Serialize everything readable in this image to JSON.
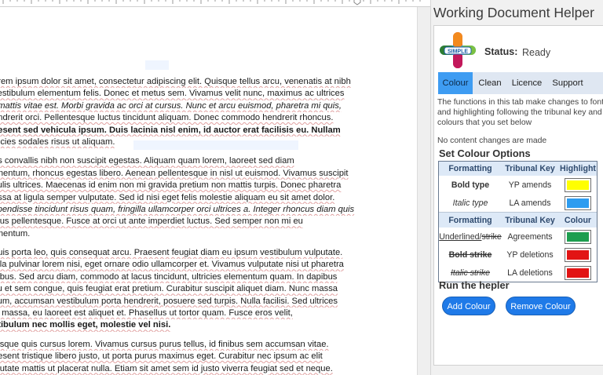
{
  "document": {
    "lines": [
      {
        "text": "orem ipsum dolor sit amet, consectetur adipiscing elit. Quisque tellus arcu, venenatis at nibh",
        "style": "sq"
      },
      {
        "text": " vestibulum elementum felis. Donec et metus sem. Vivamus velit nunc, maximus ac ultrices",
        "style": "sq"
      },
      {
        "text": ", mattis vitae est. Morbi gravida ac orci at cursus. Nunc et arcu euismod, pharetra mi quis,",
        "style": "sq i"
      },
      {
        "text": "endrerit orci. Pellentesque luctus tincidunt aliquam. Donec commodo hendrerit rhoncus.",
        "style": "sq"
      },
      {
        "text": "aesent sed vehicula ipsum. Duis lacinia nisl enim, id auctor erat facilisis eu. Nullam",
        "style": "b sq"
      },
      {
        "text": "tricies sodales risus ut aliquam.",
        "style": "sq"
      },
      {
        "text": "",
        "style": "gap"
      },
      {
        "text": "as  convallis nibh non suscipit egestas. Aliquam quam lorem, laoreet sed diam",
        "style": "sq"
      },
      {
        "text": "rmentum, rhoncus egestas libero. Aenean pellentesque in nisl ut euismod. Vivamus suscipit",
        "style": "sq"
      },
      {
        "text": "culis ultrices. Maecenas id enim non mi gravida pretium non mattis turpis. Donec pharetra",
        "style": "sq"
      },
      {
        "text": "assa at ligula semper vulputate. Sed id nisi eget felis molestie aliquam eu sit amet dolor.",
        "style": "sq"
      },
      {
        "text": "spendisse tincidunt risus quam, fringilla ullamcorper orci ultrices a. Integer rhoncus diam quis",
        "style": "sq i"
      },
      {
        "text": "ibus pellentesque. Fusce at orci ut ante imperdiet luctus. Sed semper non mi eu",
        "style": "sq"
      },
      {
        "text": "rmentum.",
        "style": ""
      },
      {
        "text": "",
        "style": "gap"
      },
      {
        "text": "quis porta leo, quis consequat arcu. Praesent feugiat diam eu ipsum vestibulum vulputate.",
        "style": "sq"
      },
      {
        "text": "ulla pulvinar lorem nisi, eget ornare odio ullamcorper et. Vivamus vulputate nisi ut pharetra",
        "style": "sq"
      },
      {
        "text": "pibus. Sed arcu diam, commodo at lacus tincidunt, ultricies elementum quam. In dapibus",
        "style": "sq"
      },
      {
        "text": "cu et sem congue, quis feugiat erat pretium. Curabitur suscipit aliquet diam. Nunc massa",
        "style": "sq"
      },
      {
        "text": "sum, accumsan vestibulum porta hendrerit, posuere sed turpis. Nulla facilisi. Sed ultrices",
        "style": "sq"
      },
      {
        "text": "is massa, eu laoreet est aliquet et. Phasellus ut tortor quam. Fusce eros velit,",
        "style": "sq"
      },
      {
        "text": "stibulum nec mollis eget, molestie vel nisi.",
        "style": "b sq"
      },
      {
        "text": "",
        "style": "gap"
      },
      {
        "text": "uisque quis cursus lorem. Vivamus cursus purus tellus, id finibus sem accumsan vitae.",
        "style": "sq"
      },
      {
        "text": "aesent tristique libero justo, ut porta purus maximus eget. Curabitur nec ipsum ac elit",
        "style": "sq"
      },
      {
        "text": "lputate mattis ut placerat nulla. Etiam sit amet sem id justo viverra feugiat sed et neque.",
        "style": "sq"
      }
    ]
  },
  "pane": {
    "title": "Working Document Helper",
    "logo_text": "SIMPLE",
    "status_label": "Status:",
    "status_value": "Ready",
    "tabs": [
      {
        "label": "Colour",
        "active": true
      },
      {
        "label": "Clean",
        "active": false
      },
      {
        "label": "Licence",
        "active": false
      },
      {
        "label": "Support",
        "active": false
      }
    ],
    "description": "The functions in this tab make changes to font and highlighting following the tribunal key and colours that you set below",
    "note": "No content changes are made",
    "set_colour_title": "Set Colour Options",
    "table": {
      "header1": {
        "formatting": "Formatting",
        "key": "Tribunal Key",
        "colour": "Highlight"
      },
      "rows1": [
        {
          "formatting": "Bold type",
          "key": "YP amends",
          "color": "#ffff00",
          "fmt": "bold"
        },
        {
          "formatting": "Italic type",
          "key": "LA amends",
          "color": "#2d9cf0",
          "fmt": "italic"
        }
      ],
      "header2": {
        "formatting": "Formatting",
        "key": "Tribunal Key",
        "colour": "Colour"
      },
      "rows2": [
        {
          "formatting_a": "Underlined/",
          "formatting_b": "strike",
          "key": "Agreements",
          "color": "#1e9e4f",
          "fmt": "ul"
        },
        {
          "formatting": "Bold strike",
          "key": "YP deletions",
          "color": "#e21414",
          "fmt": "bold-strike"
        },
        {
          "formatting": "Italic strike",
          "key": "LA deletions",
          "color": "#e21414",
          "fmt": "italic-strike"
        }
      ]
    },
    "run_title": "Run the hepler",
    "add_button": "Add Colour",
    "remove_button": "Remove Colour"
  }
}
